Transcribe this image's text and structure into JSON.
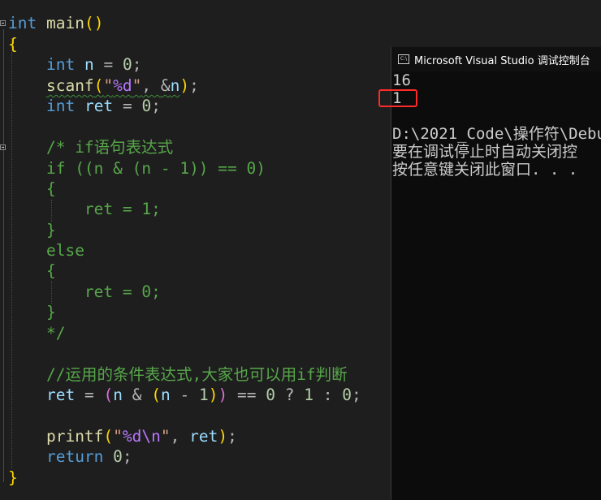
{
  "code": {
    "main_type": "int",
    "main_name": "main",
    "main_parens": "()",
    "open_brace": "{",
    "close_brace": "}",
    "l_int1": "int",
    "l_n": "n",
    "l_eq": "=",
    "l_zero1": "0",
    "l_semi": ";",
    "scanf_name": "scanf",
    "scanf_open": "(",
    "scanf_q1": "\"",
    "scanf_fmt": "%d",
    "scanf_q2": "\"",
    "scanf_comma": ", ",
    "scanf_amp": "&",
    "scanf_n": "n",
    "scanf_close": ")",
    "l_int2": "int",
    "l_ret": "ret",
    "comment_lines": [
      "/* if语句表达式",
      "if ((n & (n - 1)) == 0)",
      "{",
      "    ret = 1;",
      "}",
      "else",
      "{",
      "    ret = 0;",
      "}",
      "*/"
    ],
    "line_comment": "//运用的条件表达式,大家也可以用if判断",
    "tern_ret": "ret",
    "tern_eq": "=",
    "tern_open": "(",
    "tern_n1": "n",
    "tern_amp": "&",
    "tern_open2": "(",
    "tern_n2": "n",
    "tern_minus": "-",
    "tern_one": "1",
    "tern_close2": ")",
    "tern_close1": ")",
    "tern_eqeq": "==",
    "tern_zero": "0",
    "tern_q": "?",
    "tern_one2": "1",
    "tern_colon": ":",
    "tern_zero2": "0",
    "printf_name": "printf",
    "printf_open": "(",
    "printf_q1": "\"",
    "printf_fmt": "%d",
    "printf_esc": "\\n",
    "printf_q2": "\"",
    "printf_comma": ", ",
    "printf_ret": "ret",
    "printf_close": ")",
    "return_kw": "return",
    "return_val": "0"
  },
  "console": {
    "title": "Microsoft Visual Studio 调试控制台",
    "icon_text": "C:\\",
    "lines": [
      "16",
      "1",
      "",
      "D:\\2021_Code\\操作符\\Debu",
      "要在调试停止时自动关闭控",
      "按任意键关闭此窗口. . ."
    ]
  },
  "colors": {
    "editor_bg": "#1e1e1e",
    "keyword": "#569cd6",
    "function": "#dcdcaa",
    "string": "#d69d85",
    "comment": "#57a64a",
    "highlight_box": "#ff2a2a"
  }
}
